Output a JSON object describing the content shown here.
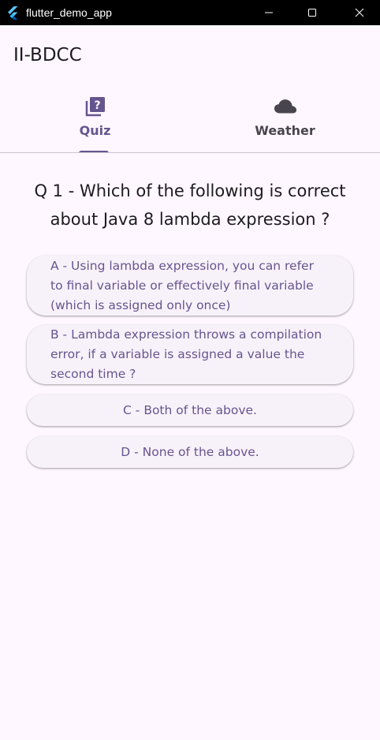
{
  "window": {
    "title": "flutter_demo_app",
    "logo_icon": "flutter-logo-icon",
    "controls": {
      "minimize_icon": "minimize-icon",
      "maximize_icon": "maximize-icon",
      "close_icon": "close-icon"
    }
  },
  "app_bar": {
    "title": "II-BDCC"
  },
  "tabs": [
    {
      "label": "Quiz",
      "icon": "quiz-icon",
      "selected": true
    },
    {
      "label": "Weather",
      "icon": "cloud-icon",
      "selected": false
    }
  ],
  "quiz": {
    "question": "Q 1 - Which of the following is correct about Java 8 lambda expression ?",
    "answers": [
      "A - Using lambda expression, you can refer to final variable or effectively final variable (which is assigned only once)",
      "B - Lambda expression throws a compilation error, if a variable is assigned a value the second time ?",
      "C - Both of the above.",
      "D - None of the above."
    ]
  },
  "colors": {
    "background": "#fef7ff",
    "primary": "#65558f",
    "titlebar": "#000000",
    "button_surface": "#f7f2fa",
    "divider": "#cac4d0",
    "text": "#1d1b20",
    "unselected_tab": "#49454f"
  }
}
